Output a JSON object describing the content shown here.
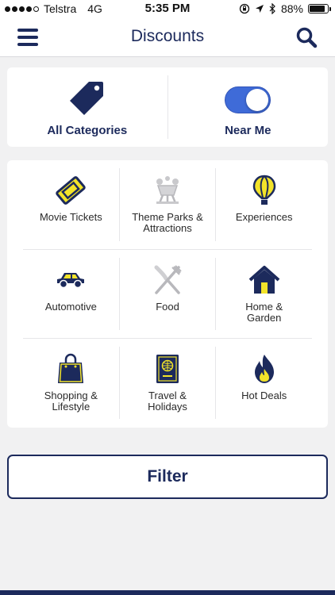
{
  "status_bar": {
    "carrier": "Telstra",
    "network": "4G",
    "time": "5:35 PM",
    "battery": "88%",
    "battery_level": 0.88
  },
  "nav": {
    "title": "Discounts",
    "menu_icon": "hamburger-menu-icon",
    "search_icon": "search-icon"
  },
  "top_options": {
    "all_categories": "All Categories",
    "near_me": "Near Me",
    "near_me_enabled": true
  },
  "categories": [
    {
      "label": "Movie Tickets",
      "icon": "ticket-icon"
    },
    {
      "label": "Theme Parks & Attractions",
      "icon": "theme-park-icon"
    },
    {
      "label": "Experiences",
      "icon": "hot-air-balloon-icon"
    },
    {
      "label": "Automotive",
      "icon": "car-icon"
    },
    {
      "label": "Food",
      "icon": "fork-knife-icon"
    },
    {
      "label": "Home & Garden",
      "icon": "house-icon"
    },
    {
      "label": "Shopping & Lifestyle",
      "icon": "shopping-bag-icon"
    },
    {
      "label": "Travel & Holidays",
      "icon": "passport-icon"
    },
    {
      "label": "Hot Deals",
      "icon": "flame-icon"
    }
  ],
  "filter_label": "Filter",
  "colors": {
    "navy": "#1c2a5c",
    "accent_yellow": "#f2e32a",
    "toggle_blue": "#3f6bd8",
    "background": "#f1f1f2"
  }
}
